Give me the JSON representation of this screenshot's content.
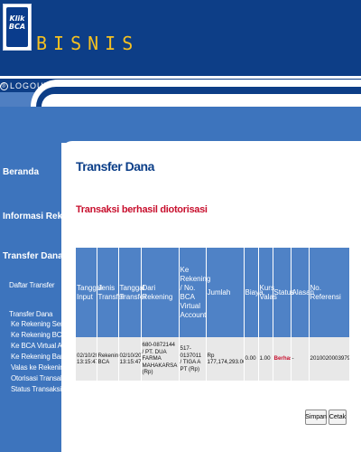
{
  "brand": {
    "logo_line1": "Klik",
    "logo_line2": "BCA",
    "title": "BISNIS"
  },
  "header": {
    "logout_label": "LOGOUT"
  },
  "sidebar": {
    "main_items": [
      {
        "label": "Beranda"
      },
      {
        "label": "Informasi Rekening"
      },
      {
        "label": "Transfer Dana"
      }
    ],
    "daftar_transfer": "Daftar Transfer",
    "transfer_dana_group": "Transfer Dana",
    "sub_items": [
      {
        "label": "Ke Rekening Sendiri"
      },
      {
        "label": "Ke Rekening BCA Lain"
      },
      {
        "label": "Ke BCA Virtual Account"
      },
      {
        "label": "Ke Rekening Bank Lain"
      },
      {
        "label": "Valas ke Rekening Bank"
      },
      {
        "label": "Otorisasi Transaksi"
      },
      {
        "label": "Status Transaksi"
      }
    ]
  },
  "main": {
    "page_title": "Transfer Dana",
    "success_message": "Transaksi berhasil diotorisasi",
    "table": {
      "headers": {
        "tanggal_input": "Tanggal Input",
        "jenis_transfer": "Jenis Transfer",
        "tanggal_transfer": "Tanggal Transfer",
        "dari_rekening": "Dari Rekening",
        "ke_rekening": "Ke Rekening / No. BCA Virtual Account",
        "jumlah": "Jumlah",
        "biaya": "Biaya",
        "kurs_valas": "Kurs Valas",
        "status": "Status",
        "alasan": "Alasan",
        "no_referensi": "No. Referensi"
      },
      "rows": [
        {
          "tanggal_input": "02/10/2020 13:15:47",
          "jenis_transfer": "Rekening BCA",
          "tanggal_transfer": "02/10/2020 13:15:47",
          "dari_rekening": "680-0872144 / PT. DUA FARMA MAHAKARSA (Rp)",
          "ke_rekening": "517-0137011 / TIGA A PT (Rp)",
          "jumlah": "Rp 177,174,293.00",
          "biaya": "0.00",
          "kurs_valas": "1.00",
          "status": "Berhasil",
          "alasan": "-",
          "no_referensi": "20100200039791"
        }
      ]
    },
    "buttons": {
      "save": "Simpan",
      "print": "Cetak"
    }
  },
  "colors": {
    "header_blue": "#0d3e87",
    "sidebar_blue": "#3d74bd",
    "table_header_blue": "#4f82c6",
    "brand_yellow": "#f4c021",
    "alert_red": "#c8102e"
  }
}
